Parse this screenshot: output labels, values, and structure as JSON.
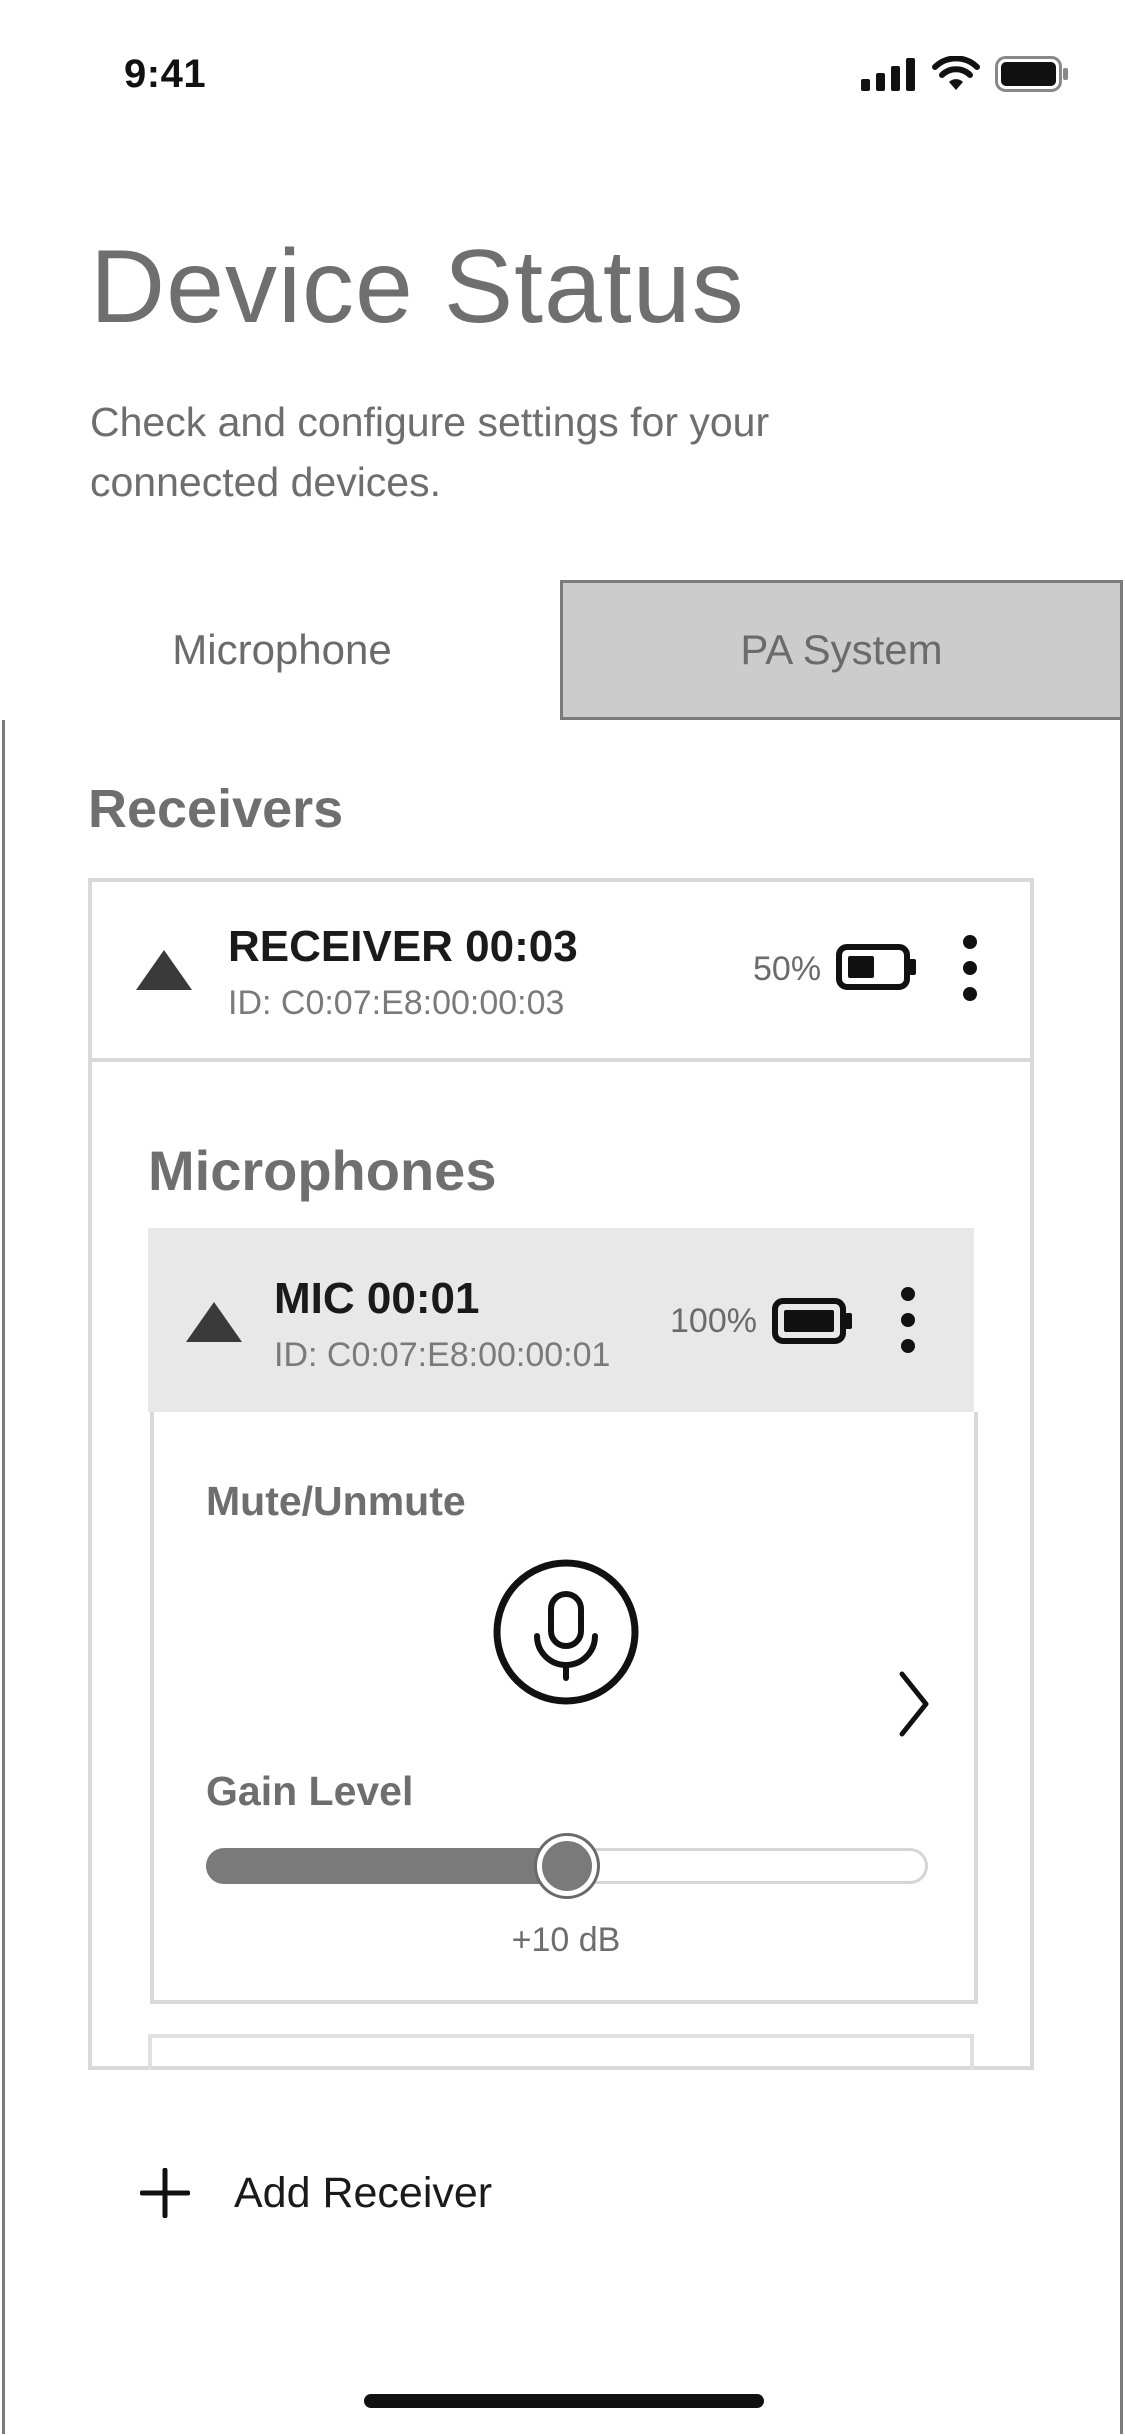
{
  "status_bar": {
    "time": "9:41",
    "icons": [
      "signal-icon",
      "wifi-icon",
      "battery-icon"
    ]
  },
  "header": {
    "title": "Device Status",
    "subtitle": "Check and configure settings for your connected devices."
  },
  "tabs": [
    {
      "label": "Microphone",
      "selected": true
    },
    {
      "label": "PA System",
      "selected": false
    }
  ],
  "receivers": {
    "title": "Receivers",
    "items": [
      {
        "name": "RECEIVER 00:03",
        "id": "ID: C0:07:E8:00:00:03",
        "battery": "50%",
        "battery_level": 0.5,
        "expanded": true,
        "microphones_title": "Microphones",
        "microphones": [
          {
            "name": "MIC 00:01",
            "id": "ID: C0:07:E8:00:00:01",
            "battery": "100%",
            "battery_level": 1.0,
            "expanded": true,
            "mute_label": "Mute/Unmute",
            "gain_label": "Gain Level",
            "gain_value": "+10 dB",
            "gain_fraction": 0.5
          }
        ]
      }
    ]
  },
  "add_receiver": {
    "label": "Add Receiver"
  },
  "colors": {
    "tab_inactive_bg": "#cccccc",
    "mic_header_bg": "#e8e8e8",
    "slider_fill": "#7a7a7a"
  }
}
